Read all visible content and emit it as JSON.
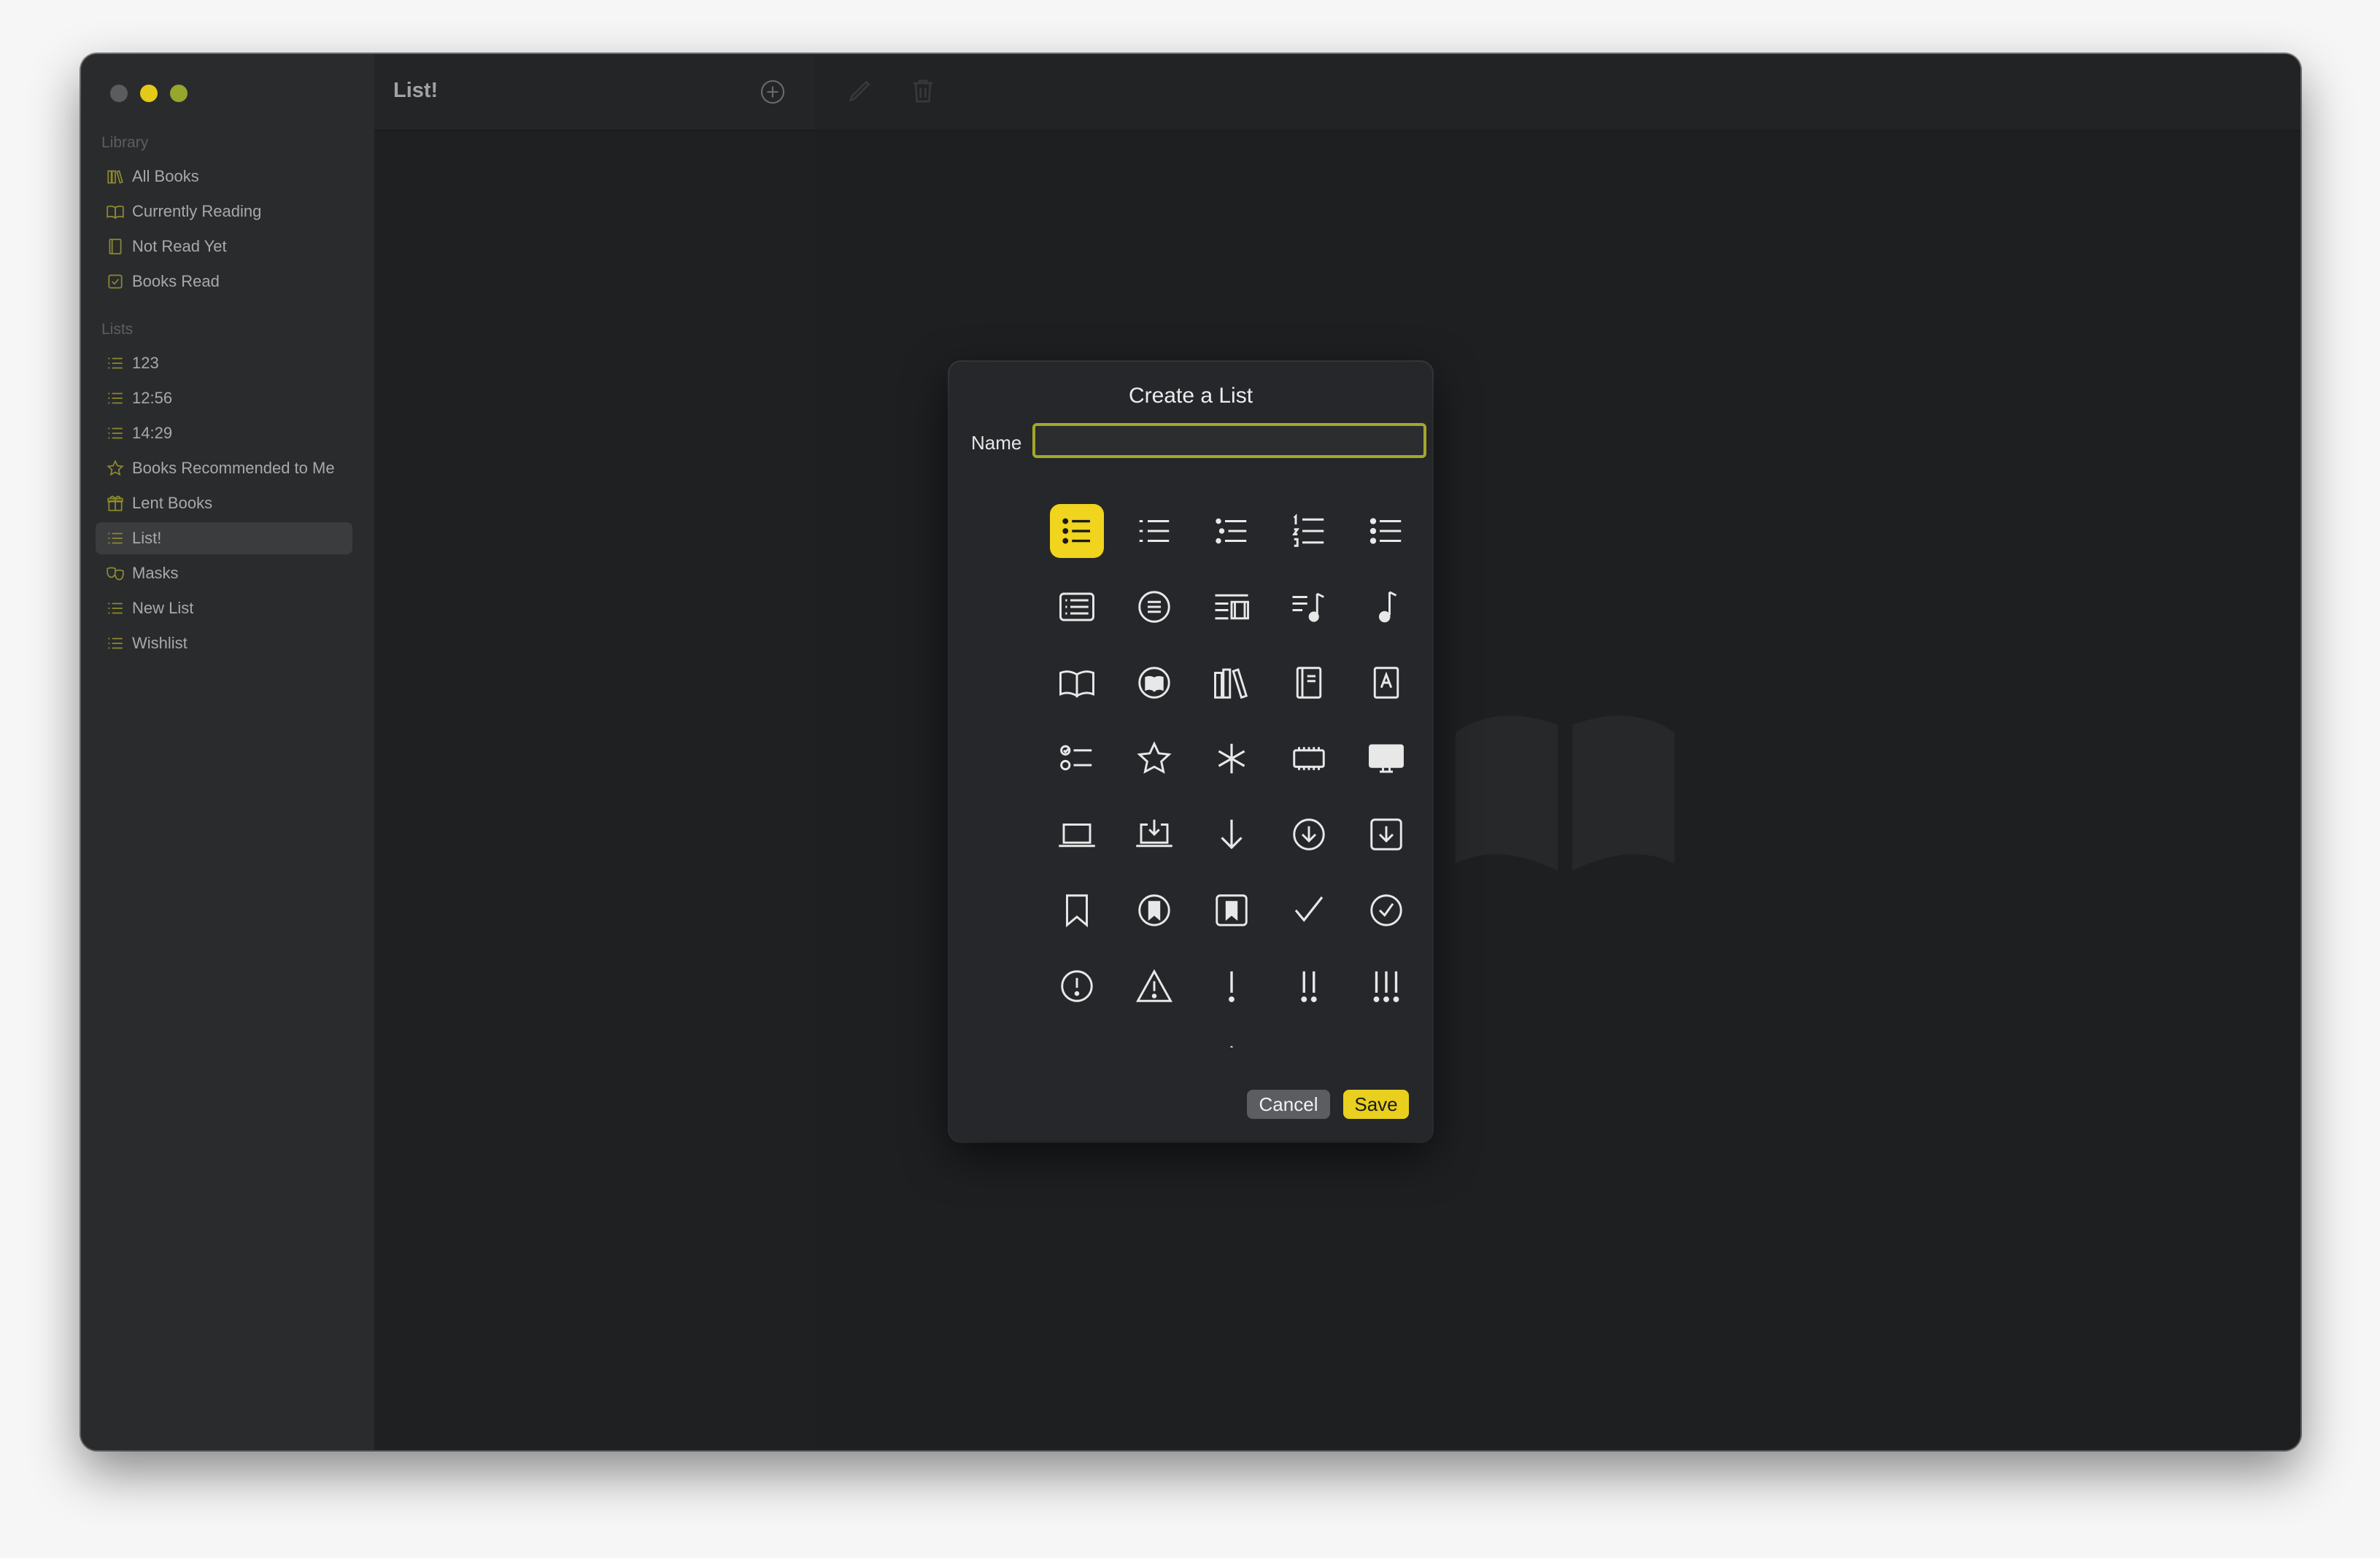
{
  "colors": {
    "accent": "#e9cf1e",
    "sidebar_icon": "#8c8a2e",
    "window_bg": "#1e1f21"
  },
  "sidebar": {
    "library_header": "Library",
    "library_items": [
      {
        "label": "All Books",
        "icon": "books-icon"
      },
      {
        "label": "Currently Reading",
        "icon": "open-book-icon"
      },
      {
        "label": "Not Read Yet",
        "icon": "closed-book-icon"
      },
      {
        "label": "Books Read",
        "icon": "checkbox-icon"
      }
    ],
    "lists_header": "Lists",
    "list_items": [
      {
        "label": "123",
        "icon": "list-icon"
      },
      {
        "label": "12:56",
        "icon": "list-icon"
      },
      {
        "label": "14:29",
        "icon": "list-icon"
      },
      {
        "label": "Books Recommended to Me",
        "icon": "star-icon"
      },
      {
        "label": "Lent Books",
        "icon": "gift-icon"
      },
      {
        "label": "List!",
        "icon": "list-icon",
        "selected": true
      },
      {
        "label": "Masks",
        "icon": "masks-icon"
      },
      {
        "label": "New List",
        "icon": "list-icon"
      },
      {
        "label": "Wishlist",
        "icon": "list-icon"
      }
    ]
  },
  "listpane": {
    "title": "List!",
    "add_icon": "plus-circle-icon"
  },
  "toolbar": {
    "edit_icon": "pencil-icon",
    "delete_icon": "trash-icon"
  },
  "dialog": {
    "title": "Create a List",
    "name_label": "Name",
    "name_value": "",
    "cancel_label": "Cancel",
    "save_label": "Save",
    "selected_icon": "list-bullet-icon",
    "icons": [
      "list-bullet-icon",
      "list-dash-icon",
      "list-bullet-indent-icon",
      "list-number-icon",
      "list-star-icon",
      "list-rectangle-icon",
      "list-circle-icon",
      "list-film-icon",
      "music-list-icon",
      "music-note-icon",
      "open-book-icon",
      "book-circle-icon",
      "books-vertical-icon",
      "closed-book-icon",
      "address-book-icon",
      "checklist-icon",
      "star-icon",
      "asterisk-icon",
      "memory-chip-icon",
      "desktop-icon",
      "laptop-icon",
      "laptop-download-icon",
      "arrow-down-icon",
      "arrow-down-circle-icon",
      "arrow-down-square-icon",
      "bookmark-icon",
      "bookmark-circle-icon",
      "bookmark-square-icon",
      "checkmark-icon",
      "checkmark-circle-icon",
      "exclamation-circle-icon",
      "warning-triangle-icon",
      "exclamation-icon",
      "double-exclamation-icon",
      "triple-exclamation-icon",
      "arrow-turn-icon",
      "speedometer-icon",
      "share-icon",
      "person-icon",
      "two-persons-icon"
    ]
  }
}
